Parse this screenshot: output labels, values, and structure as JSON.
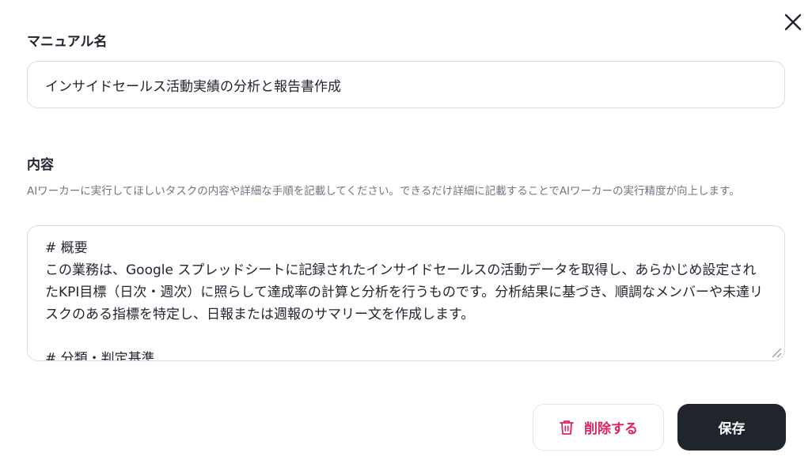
{
  "dialog": {
    "close_icon": "close-icon"
  },
  "name_field": {
    "label": "マニュアル名",
    "value": "インサイドセールス活動実績の分析と報告書作成"
  },
  "content_field": {
    "label": "内容",
    "help_text": "AIワーカーに実行してほしいタスクの内容や詳細な手順を記載してください。できるだけ詳細に記載することでAIワーカーの実行精度が向上します。",
    "value": "# 概要\nこの業務は、Google スプレッドシートに記録されたインサイドセールスの活動データを取得し、あらかじめ設定されたKPI目標（日次・週次）に照らして達成率の計算と分析を行うものです。分析結果に基づき、順調なメンバーや未達リスクのある指標を特定し、日報または週報のサマリー文を作成します。\n\n# 分類・判定基準"
  },
  "actions": {
    "delete_label": "削除する",
    "delete_icon": "trash-icon",
    "save_label": "保存"
  },
  "colors": {
    "danger": "#e0245e",
    "primary_button": "#20242b",
    "border": "#d9dce1",
    "help_text": "#6f7581"
  }
}
